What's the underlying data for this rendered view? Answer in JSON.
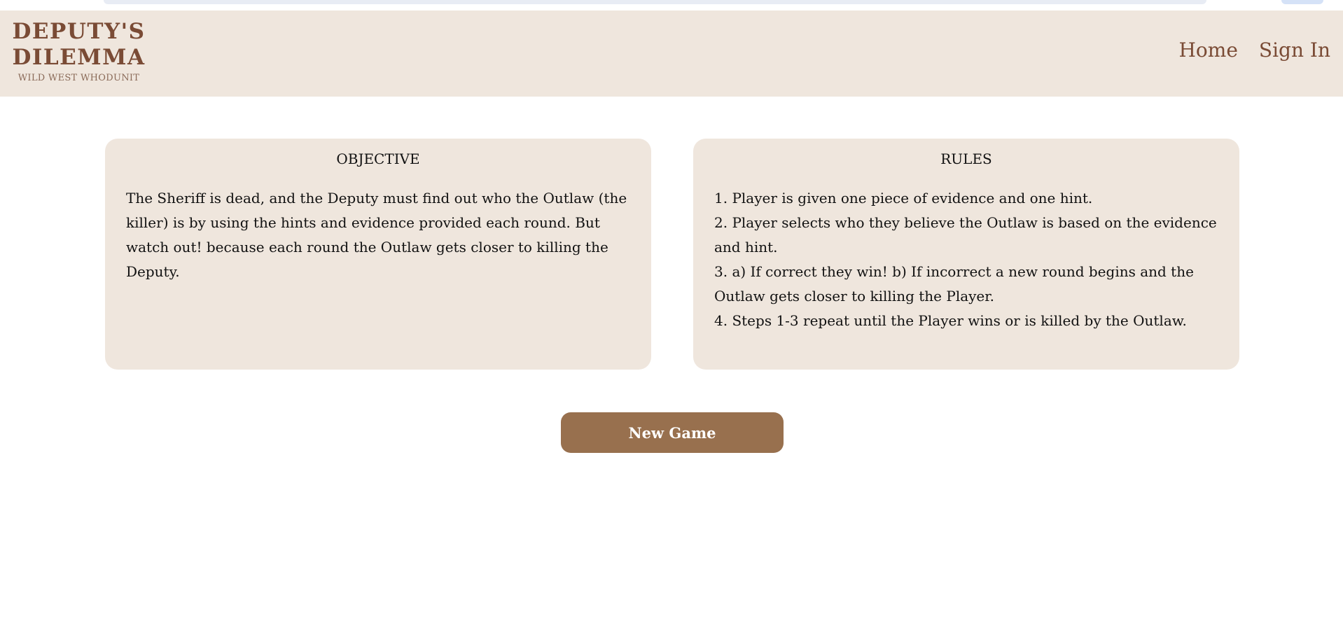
{
  "header": {
    "logo_title_line1": "DEPUTY'S",
    "logo_title_line2": "DILEMMA",
    "logo_subtitle": "WILD WEST WHODUNIT",
    "nav": {
      "home": "Home",
      "sign_in": "Sign In"
    }
  },
  "objective": {
    "title": "OBJECTIVE",
    "text": "The Sheriff is dead, and the Deputy must find out who the Outlaw (the killer) is by using the hints and evidence provided each round. But watch out! because each round the Outlaw gets closer to killing the Deputy."
  },
  "rules": {
    "title": "RULES",
    "items": [
      "1. Player is given one piece of evidence and one hint.",
      "2. Player selects who they believe the Outlaw is based on the evidence and hint.",
      "3. a) If correct they win! b) If incorrect a new round begins and the Outlaw gets closer to killing the Player.",
      "4. Steps 1-3 repeat until the Player wins or is killed by the Outlaw."
    ]
  },
  "actions": {
    "new_game": "New Game"
  },
  "colors": {
    "header_bg": "#efe6dd",
    "brand_brown": "#7a4b35",
    "card_bg": "#efe6dd",
    "button_bg": "#98704e",
    "button_text": "#ffffff"
  }
}
